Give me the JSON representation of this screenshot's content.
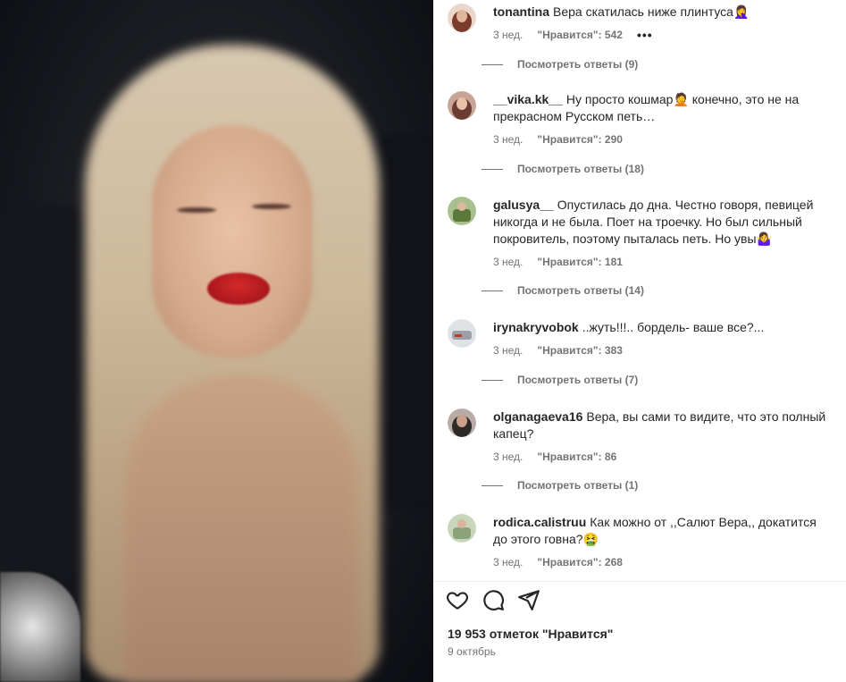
{
  "post": {
    "likes_total": "19 953 отметок \"Нравится\"",
    "date": "9 октябрь"
  },
  "comments": [
    {
      "username": "tonantina",
      "text": "Вера скатилась ниже плинтуса🤦‍♀️",
      "time": "3 нед.",
      "likes": "\"Нравится\": 542",
      "more": "•••",
      "replies": "Посмотреть ответы (9)",
      "avatar_color": "#7a3b2c"
    },
    {
      "username": "__vika.kk__",
      "text": "Ну просто кошмар🤦 конечно, это не на прекрасном Русском петь…",
      "time": "3 нед.",
      "likes": "\"Нравится\": 290",
      "replies": "Посмотреть ответы (18)",
      "avatar_color": "#6b3a32"
    },
    {
      "username": "galusya__",
      "text": "Опустилась до дна. Честно говоря, певицей никогда и не была. Поет на троечку. Но был сильный покровитель, поэтому пыталась петь. Но увы🤷‍♀️",
      "time": "3 нед.",
      "likes": "\"Нравится\": 181",
      "replies": "Посмотреть ответы (14)",
      "avatar_color": "#5b7a3a"
    },
    {
      "username": "irynakryvobok",
      "text": "..жуть!!!.. бордель- ваше все?...",
      "time": "3 нед.",
      "likes": "\"Нравится\": 383",
      "replies": "Посмотреть ответы (7)",
      "avatar_color": "#9aa0a6"
    },
    {
      "username": "olganagaeva16",
      "text": "Вера, вы сами то видите, что это полный капец?",
      "time": "3 нед.",
      "likes": "\"Нравится\": 86",
      "replies": "Посмотреть ответы (1)",
      "avatar_color": "#2e2a28"
    },
    {
      "username": "rodica.calistruu",
      "text": "Как можно от ,,Салют Вера,, докатится до этого говна?🤮 ",
      "time": "3 нед.",
      "likes": "\"Нравится\": 268",
      "avatar_color": "#8aa37a"
    }
  ],
  "icons": [
    "heart-icon",
    "comment-icon",
    "share-icon"
  ]
}
